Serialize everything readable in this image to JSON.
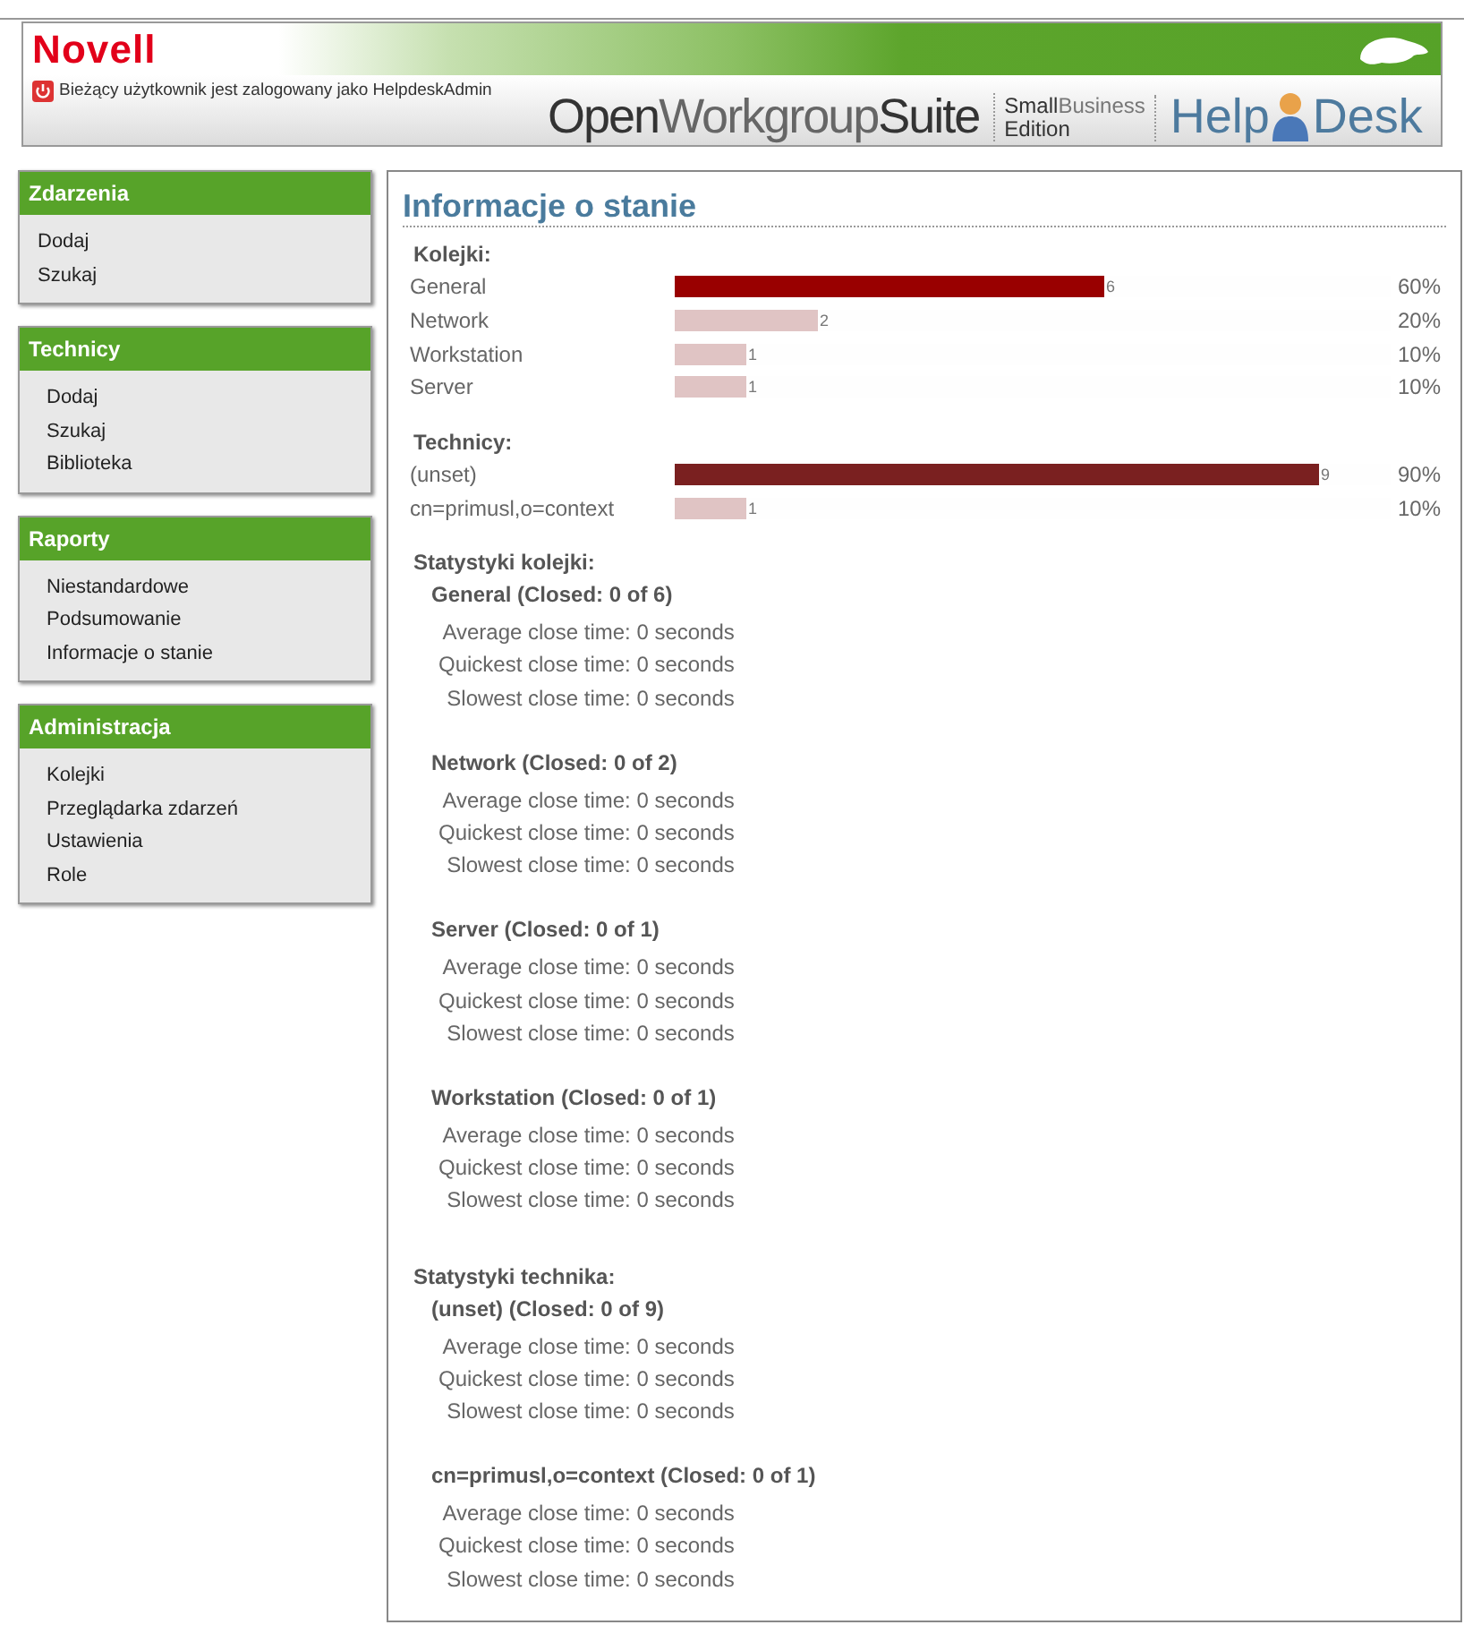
{
  "header": {
    "brand": "Novell",
    "user_status": "Bieżący użytkownik jest zalogowany jako HelpdeskAdmin",
    "suite": {
      "part_1": "Open",
      "part_2": "Workgroup",
      "part_3": "Suite"
    },
    "edition": {
      "part_1": "Small",
      "part_2": "Business",
      "line_2": "Edition"
    },
    "product": {
      "part_1": "Help",
      "part_2": "Desk"
    }
  },
  "sidebar": [
    {
      "title": "Zdarzenia",
      "items": [
        "Dodaj",
        "Szukaj"
      ]
    },
    {
      "title": "Technicy",
      "items": [
        "Dodaj",
        "Szukaj",
        "Biblioteka"
      ]
    },
    {
      "title": "Raporty",
      "items": [
        "Niestandardowe",
        "Podsumowanie",
        "Informacje o stanie"
      ]
    },
    {
      "title": "Administracja",
      "items": [
        "Kolejki",
        "Przeglądarka zdarzeń",
        "Ustawienia",
        "Role"
      ]
    }
  ],
  "main": {
    "title": "Informacje o stanie",
    "bar_groups": [
      {
        "title": "Kolejki:",
        "rows": [
          {
            "label": "General",
            "level": 0.6,
            "count": "6",
            "percent": "60%",
            "color": "#990000"
          },
          {
            "label": "Network",
            "level": 0.2,
            "count": "2",
            "percent": "20%",
            "color": "#e0c4c4"
          },
          {
            "label": "Workstation",
            "level": 0.1,
            "count": "1",
            "percent": "10%",
            "color": "#e0c4c4"
          },
          {
            "label": "Server",
            "level": 0.1,
            "count": "1",
            "percent": "10%",
            "color": "#e0c4c4"
          }
        ]
      },
      {
        "title": "Technicy:",
        "rows": [
          {
            "label": "(unset)",
            "level": 0.9,
            "count": "9",
            "percent": "90%",
            "color": "#7a2020"
          },
          {
            "label": "cn=primusl,o=context",
            "level": 0.1,
            "count": "1",
            "percent": "10%",
            "color": "#e0c4c4"
          }
        ]
      }
    ],
    "stat_sections": [
      {
        "title": "Statystyki kolejki:",
        "groups": [
          {
            "title": "General (Closed: 0 of 6)",
            "lines": [
              "Average close time: 0 seconds",
              "Quickest close time: 0 seconds",
              "Slowest close time: 0 seconds"
            ]
          },
          {
            "title": "Network (Closed: 0 of 2)",
            "lines": [
              "Average close time: 0 seconds",
              "Quickest close time: 0 seconds",
              "Slowest close time: 0 seconds"
            ]
          },
          {
            "title": "Server (Closed: 0 of 1)",
            "lines": [
              "Average close time: 0 seconds",
              "Quickest close time: 0 seconds",
              "Slowest close time: 0 seconds"
            ]
          },
          {
            "title": "Workstation (Closed: 0 of 1)",
            "lines": [
              "Average close time: 0 seconds",
              "Quickest close time: 0 seconds",
              "Slowest close time: 0 seconds"
            ]
          }
        ]
      },
      {
        "title": "Statystyki technika:",
        "groups": [
          {
            "title": "(unset) (Closed: 0 of 9)",
            "lines": [
              "Average close time: 0 seconds",
              "Quickest close time: 0 seconds",
              "Slowest close time: 0 seconds"
            ]
          },
          {
            "title": "cn=primusl,o=context (Closed: 0 of 1)",
            "lines": [
              "Average close time: 0 seconds",
              "Quickest close time: 0 seconds",
              "Slowest close time: 0 seconds"
            ]
          }
        ]
      }
    ]
  }
}
